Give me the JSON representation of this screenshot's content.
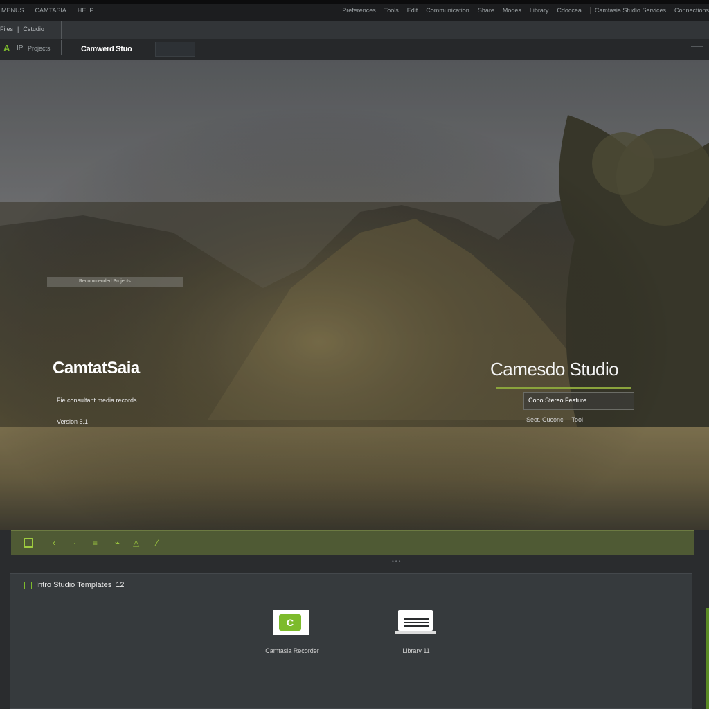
{
  "topbar": {
    "left_items": [
      "MENUS",
      "CAMTASIA",
      "HELP"
    ],
    "right_items": [
      "Preferences",
      "Tools",
      "Edit",
      "Communication",
      "Share",
      "Modes",
      "Library",
      "Cdoccea",
      "Camtasia Studio Services",
      "Connections"
    ]
  },
  "subbar": {
    "items": [
      "Files",
      "Cstudio"
    ]
  },
  "toolbar": {
    "logo": "A",
    "lp": "IP",
    "project": "Projects",
    "title": "Camwerd Stuo"
  },
  "hero": {
    "left_title": "CamtatSaia",
    "left_subtitle": "Fie consultant media records",
    "left_version": "Version 5.1",
    "right_title": "Camesdo Studio",
    "right_button": "Cobo Stereo Feature",
    "right_link_a": "Sect. Cuconc",
    "right_link_b": "Tool",
    "strip_text": "Recommended Projects"
  },
  "timeline": {
    "tool_icons": [
      "folder-icon",
      "cut-icon",
      "split-icon",
      "marker-icon",
      "annotation-icon",
      "cursor-icon"
    ]
  },
  "panel": {
    "header": "Intro Studio Templates",
    "header_count": "12",
    "card1_letter": "C",
    "card1_label": "Camtasia Recorder",
    "card2_label": "Library 11"
  },
  "colors": {
    "accent": "#7dbb2c",
    "timeline_bg": "#4f5a34",
    "panel_bg": "#363a3d"
  }
}
